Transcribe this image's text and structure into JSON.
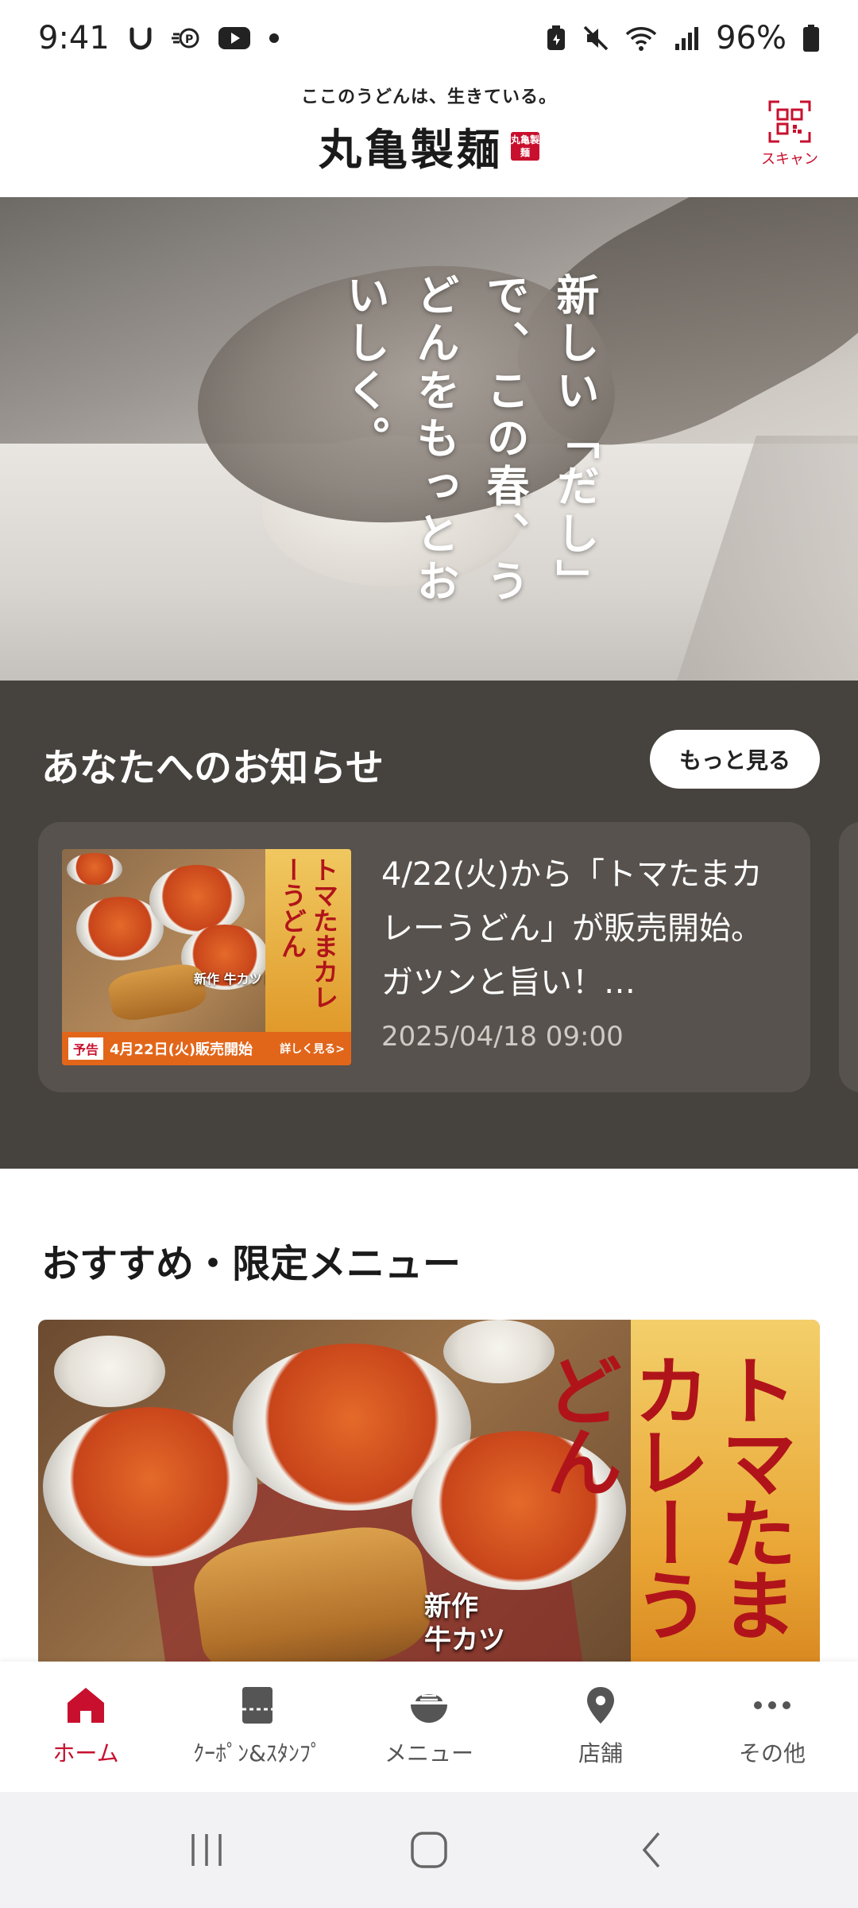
{
  "status_bar": {
    "time": "9:41",
    "battery": "96%",
    "icons": [
      "mail-u-icon",
      "pay-icon",
      "youtube-icon",
      "dot-icon",
      "battery-saver-icon",
      "mute-icon",
      "wifi-icon",
      "signal-icon",
      "battery-icon"
    ]
  },
  "header": {
    "tagline": "ここのうどんは、生きている。",
    "brand": "丸亀製麺",
    "seal": "丸亀製麺",
    "scan_label": "スキャン"
  },
  "hero": {
    "copy": "新しい「だし」で、この春、うどんをもっとおいしく。"
  },
  "news": {
    "title": "あなたへのお知らせ",
    "more_label": "もっと見る",
    "items": [
      {
        "body": "4/22(火)から「トマたまカレーうどん」が販売開始。ガツンと旨い！…",
        "date": "2025/04/18 09:00",
        "thumb_title": "トマたまカレーうどん",
        "thumb_badge": "予告",
        "thumb_banner": "4月22日(火)販売開始",
        "thumb_link": "詳しく見る>",
        "thumb_new": "新作 牛カツトマたまカレー"
      }
    ]
  },
  "recommended": {
    "title": "おすすめ・限定メニュー",
    "banner_title": "トマたまカレーうどん",
    "banner_new": "新作",
    "banner_sub": "牛カツ"
  },
  "bottom_nav": {
    "items": [
      {
        "label": "ホーム",
        "icon": "home-icon",
        "active": true
      },
      {
        "label": "ｸｰﾎﾟﾝ&ｽﾀﾝﾌﾟ",
        "icon": "coupon-icon",
        "active": false
      },
      {
        "label": "メニュー",
        "icon": "bowl-icon",
        "active": false
      },
      {
        "label": "店舗",
        "icon": "location-pin-icon",
        "active": false
      },
      {
        "label": "その他",
        "icon": "more-dots-icon",
        "active": false
      }
    ]
  },
  "colors": {
    "accent": "#c8102e",
    "news_bg": "#46423e",
    "news_card": "#57524d"
  }
}
